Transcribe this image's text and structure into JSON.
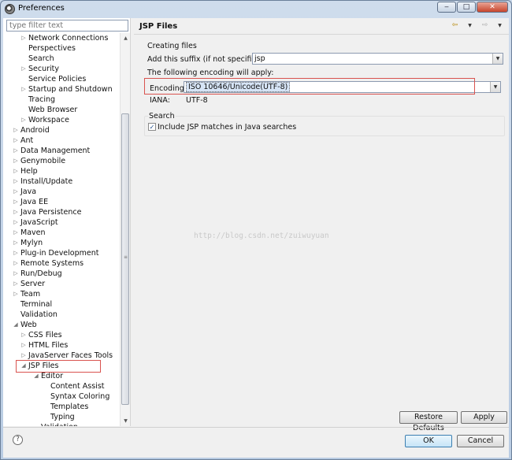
{
  "window": {
    "title": "Preferences",
    "minimize": "‒",
    "maximize": "□",
    "close": "✕"
  },
  "filter": {
    "placeholder": "type filter text"
  },
  "tree": [
    {
      "label": "Network Connections",
      "level": 1,
      "arrow": "collapsed"
    },
    {
      "label": "Perspectives",
      "level": 1,
      "arrow": "none"
    },
    {
      "label": "Search",
      "level": 1,
      "arrow": "none"
    },
    {
      "label": "Security",
      "level": 1,
      "arrow": "collapsed"
    },
    {
      "label": "Service Policies",
      "level": 1,
      "arrow": "none"
    },
    {
      "label": "Startup and Shutdown",
      "level": 1,
      "arrow": "collapsed"
    },
    {
      "label": "Tracing",
      "level": 1,
      "arrow": "none"
    },
    {
      "label": "Web Browser",
      "level": 1,
      "arrow": "none"
    },
    {
      "label": "Workspace",
      "level": 1,
      "arrow": "collapsed"
    },
    {
      "label": "Android",
      "level": 0,
      "arrow": "collapsed"
    },
    {
      "label": "Ant",
      "level": 0,
      "arrow": "collapsed"
    },
    {
      "label": "Data Management",
      "level": 0,
      "arrow": "collapsed"
    },
    {
      "label": "Genymobile",
      "level": 0,
      "arrow": "collapsed"
    },
    {
      "label": "Help",
      "level": 0,
      "arrow": "collapsed"
    },
    {
      "label": "Install/Update",
      "level": 0,
      "arrow": "collapsed"
    },
    {
      "label": "Java",
      "level": 0,
      "arrow": "collapsed"
    },
    {
      "label": "Java EE",
      "level": 0,
      "arrow": "collapsed"
    },
    {
      "label": "Java Persistence",
      "level": 0,
      "arrow": "collapsed"
    },
    {
      "label": "JavaScript",
      "level": 0,
      "arrow": "collapsed"
    },
    {
      "label": "Maven",
      "level": 0,
      "arrow": "collapsed"
    },
    {
      "label": "Mylyn",
      "level": 0,
      "arrow": "collapsed"
    },
    {
      "label": "Plug-in Development",
      "level": 0,
      "arrow": "collapsed"
    },
    {
      "label": "Remote Systems",
      "level": 0,
      "arrow": "collapsed"
    },
    {
      "label": "Run/Debug",
      "level": 0,
      "arrow": "collapsed"
    },
    {
      "label": "Server",
      "level": 0,
      "arrow": "collapsed"
    },
    {
      "label": "Team",
      "level": 0,
      "arrow": "collapsed"
    },
    {
      "label": "Terminal",
      "level": 0,
      "arrow": "none"
    },
    {
      "label": "Validation",
      "level": 0,
      "arrow": "none"
    },
    {
      "label": "Web",
      "level": 0,
      "arrow": "expanded"
    },
    {
      "label": "CSS Files",
      "level": 1,
      "arrow": "collapsed"
    },
    {
      "label": "HTML Files",
      "level": 1,
      "arrow": "collapsed"
    },
    {
      "label": "JavaServer Faces Tools",
      "level": 1,
      "arrow": "collapsed"
    },
    {
      "label": "JSP Files",
      "level": 1,
      "arrow": "expanded"
    },
    {
      "label": "Editor",
      "level": 2,
      "arrow": "expanded"
    },
    {
      "label": "Content Assist",
      "level": 3,
      "arrow": "none"
    },
    {
      "label": "Syntax Coloring",
      "level": 3,
      "arrow": "none"
    },
    {
      "label": "Templates",
      "level": 3,
      "arrow": "none"
    },
    {
      "label": "Typing",
      "level": 3,
      "arrow": "none"
    },
    {
      "label": "Validation",
      "level": 2,
      "arrow": "none"
    }
  ],
  "page": {
    "title": "JSP Files",
    "creating_group": "Creating files",
    "suffix_label": "Add this suffix (if not specified):",
    "suffix_value": "jsp",
    "encoding_intro": "The following encoding will apply:",
    "encoding_label": "Encoding:",
    "encoding_value": "ISO 10646/Unicode(UTF-8)",
    "iana_label": "IANA:",
    "iana_value": "UTF-8",
    "search_group": "Search",
    "include_jsp_label": "Include JSP matches in Java searches",
    "include_jsp_checked": true,
    "watermark": "http://blog.csdn.net/zuiwuyuan"
  },
  "buttons": {
    "restore_defaults": "Restore Defaults",
    "apply": "Apply",
    "ok": "OK",
    "cancel": "Cancel"
  },
  "icons": {
    "back": "back-arrow-icon",
    "forward": "forward-arrow-icon",
    "menu": "view-menu-icon",
    "help": "help-icon"
  },
  "colors": {
    "highlight_annotation": "#d9534f",
    "selection": "#d6e4f6",
    "window_frame": "#c9d8ea"
  }
}
